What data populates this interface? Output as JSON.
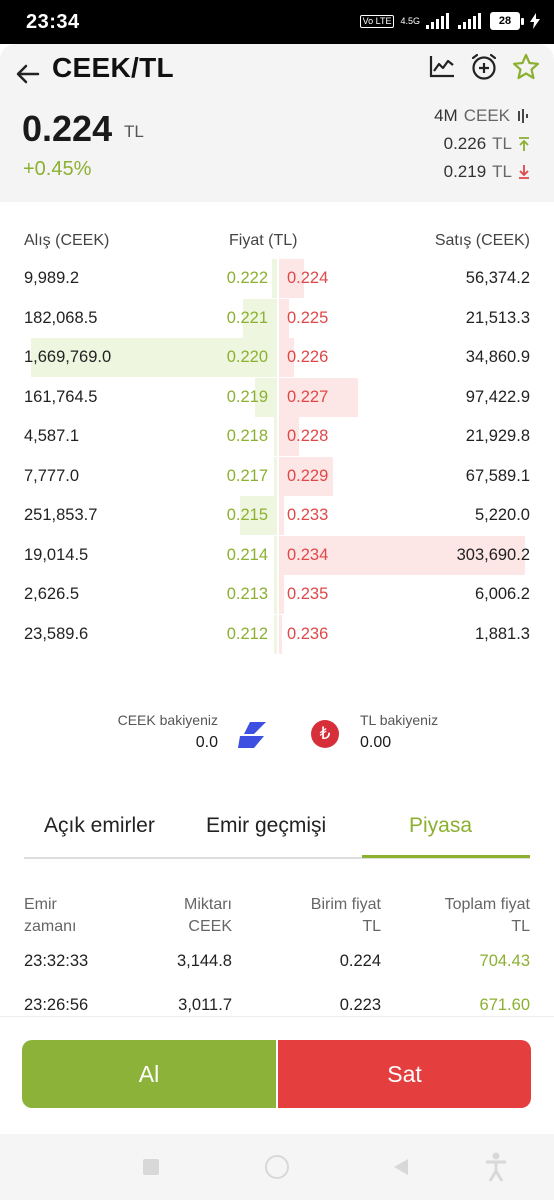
{
  "status_bar": {
    "time": "23:34",
    "volte": "Vo LTE",
    "network": "4.5G",
    "battery": "28"
  },
  "header": {
    "title": "CEEK/TL",
    "price": "0.224",
    "price_unit": "TL",
    "change": "+0.45%",
    "volume_value": "4M",
    "volume_unit": "CEEK",
    "high_value": "0.226",
    "high_unit": "TL",
    "low_value": "0.219",
    "low_unit": "TL",
    "icons": [
      "back-arrow-icon",
      "chart-icon",
      "alarm-add-icon",
      "star-icon"
    ]
  },
  "orderbook": {
    "headers": {
      "bid": "Alış (CEEK)",
      "price": "Fiyat (TL)",
      "ask": "Satış (CEEK)"
    },
    "rows": [
      {
        "bid_amount": "9,989.2",
        "bid_price": "0.222",
        "ask_price": "0.224",
        "ask_amount": "56,374.2",
        "bid_depth": 0.02,
        "ask_depth": 0.1
      },
      {
        "bid_amount": "182,068.5",
        "bid_price": "0.221",
        "ask_price": "0.225",
        "ask_amount": "21,513.3",
        "bid_depth": 0.14,
        "ask_depth": 0.04
      },
      {
        "bid_amount": "1,669,769.0",
        "bid_price": "0.220",
        "ask_price": "0.226",
        "ask_amount": "34,860.9",
        "bid_depth": 1.0,
        "ask_depth": 0.06
      },
      {
        "bid_amount": "161,764.5",
        "bid_price": "0.219",
        "ask_price": "0.227",
        "ask_amount": "97,422.9",
        "bid_depth": 0.09,
        "ask_depth": 0.32
      },
      {
        "bid_amount": "4,587.1",
        "bid_price": "0.218",
        "ask_price": "0.228",
        "ask_amount": "21,929.8",
        "bid_depth": 0.01,
        "ask_depth": 0.08
      },
      {
        "bid_amount": "7,777.0",
        "bid_price": "0.217",
        "ask_price": "0.229",
        "ask_amount": "67,589.1",
        "bid_depth": 0.01,
        "ask_depth": 0.22
      },
      {
        "bid_amount": "251,853.7",
        "bid_price": "0.215",
        "ask_price": "0.233",
        "ask_amount": "5,220.0",
        "bid_depth": 0.15,
        "ask_depth": 0.02
      },
      {
        "bid_amount": "19,014.5",
        "bid_price": "0.214",
        "ask_price": "0.234",
        "ask_amount": "303,690.2",
        "bid_depth": 0.01,
        "ask_depth": 1.0
      },
      {
        "bid_amount": "2,626.5",
        "bid_price": "0.213",
        "ask_price": "0.235",
        "ask_amount": "6,006.2",
        "bid_depth": 0.01,
        "ask_depth": 0.02
      },
      {
        "bid_amount": "23,589.6",
        "bid_price": "0.212",
        "ask_price": "0.236",
        "ask_amount": "1,881.3",
        "bid_depth": 0.01,
        "ask_depth": 0.01
      }
    ]
  },
  "balances": {
    "base_label": "CEEK bakiyeniz",
    "base_value": "0.0",
    "quote_label": "TL bakiyeniz",
    "quote_value": "0.00",
    "quote_icon": "₺"
  },
  "tabs": [
    {
      "label": "Açık emirler",
      "active": false
    },
    {
      "label": "Emir geçmişi",
      "active": false
    },
    {
      "label": "Piyasa",
      "active": true
    }
  ],
  "trades": {
    "headers": {
      "time_1": "Emir",
      "time_2": "zamanı",
      "qty_1": "Miktarı",
      "qty_2": "CEEK",
      "unit_1": "Birim fiyat",
      "unit_2": "TL",
      "total_1": "Toplam fiyat",
      "total_2": "TL"
    },
    "rows": [
      {
        "time": "23:32:33",
        "qty": "3,144.8",
        "unit": "0.224",
        "total": "704.43"
      },
      {
        "time": "23:26:56",
        "qty": "3,011.7",
        "unit": "0.223",
        "total": "671.60"
      }
    ]
  },
  "actions": {
    "buy": "Al",
    "sell": "Sat"
  },
  "colors": {
    "buy": "#8cb23a",
    "sell": "#e53e3e",
    "bid_text": "#8cb030",
    "ask_text": "#e04848"
  }
}
